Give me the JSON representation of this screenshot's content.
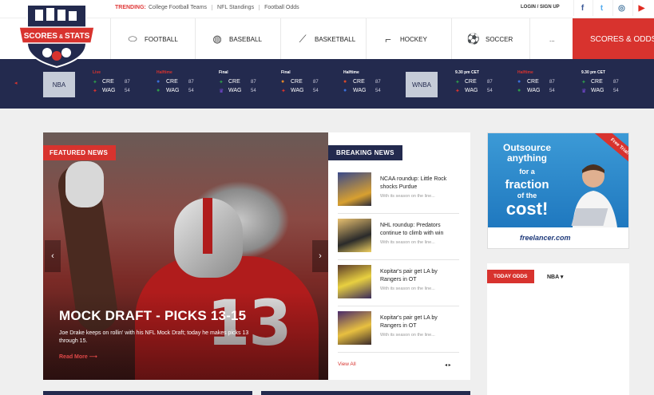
{
  "trending": {
    "label": "TRENDING:",
    "links": [
      "College Football Teams",
      "NFL Standings",
      "Football Odds"
    ]
  },
  "account": {
    "login": "LOGIN / SIGN UP"
  },
  "social": [
    {
      "name": "facebook-icon",
      "glyph": "f",
      "color": "#3b5998"
    },
    {
      "name": "twitter-icon",
      "glyph": "t",
      "color": "#55acee"
    },
    {
      "name": "instagram-icon",
      "glyph": "◎",
      "color": "#3f729b"
    },
    {
      "name": "youtube-icon",
      "glyph": "▶",
      "color": "#e02a20"
    }
  ],
  "logo": {
    "line1": "SCORES",
    "amp": "&",
    "line2": "STATS"
  },
  "nav": {
    "items": [
      {
        "label": "FOOTBALL",
        "icon": "football-icon",
        "glyph": "⬭"
      },
      {
        "label": "BASEBALL",
        "icon": "baseball-icon",
        "glyph": "◍"
      },
      {
        "label": "BASKETBALL",
        "icon": "basketball-icon",
        "glyph": "⟋"
      },
      {
        "label": "HOCKEY",
        "icon": "hockey-stick-icon",
        "glyph": "⌐"
      },
      {
        "label": "SOCCER",
        "icon": "soccer-ball-icon",
        "glyph": "⚽"
      },
      {
        "label": "...",
        "icon": "",
        "glyph": ""
      }
    ],
    "scores_label": "SCORES & ODDS"
  },
  "scores": {
    "leagues": [
      "NBA",
      "WNBA"
    ],
    "games": [
      {
        "status": "Live",
        "status_color": "#d8332e",
        "team1": "CRE",
        "score1": "87",
        "team2": "WAG",
        "score2": "54",
        "i1": "✦",
        "c1": "#2e9a4a",
        "i2": "✦",
        "c2": "#d8332e"
      },
      {
        "status": "Halftime",
        "status_color": "#d8332e",
        "team1": "CRE",
        "score1": "87",
        "team2": "WAG",
        "score2": "54",
        "i1": "●",
        "c1": "#3a6fd8",
        "i2": "●",
        "c2": "#2e9a4a"
      },
      {
        "status": "Final",
        "status_color": "#ffffff",
        "team1": "CRE",
        "score1": "87",
        "team2": "WAG",
        "score2": "54",
        "i1": "✦",
        "c1": "#2e9a4a",
        "i2": "♛",
        "c2": "#7a4ad8"
      },
      {
        "status": "Final",
        "status_color": "#ffffff",
        "team1": "CRE",
        "score1": "87",
        "team2": "WAG",
        "score2": "54",
        "i1": "●",
        "c1": "#e0862a",
        "i2": "✦",
        "c2": "#d8332e"
      },
      {
        "status": "Halftime",
        "status_color": "#ffffff",
        "team1": "CRE",
        "score1": "87",
        "team2": "WAG",
        "score2": "54",
        "i1": "●",
        "c1": "#d84a2a",
        "i2": "●",
        "c2": "#3a6fd8"
      },
      {
        "status": "9.30 pm CET",
        "status_color": "#ffffff",
        "team1": "CRE",
        "score1": "87",
        "team2": "WAG",
        "score2": "54",
        "i1": "✦",
        "c1": "#2e9a4a",
        "i2": "✦",
        "c2": "#d8332e"
      },
      {
        "status": "Halftime",
        "status_color": "#d8332e",
        "team1": "CRE",
        "score1": "87",
        "team2": "WAG",
        "score2": "54",
        "i1": "●",
        "c1": "#3a6fd8",
        "i2": "●",
        "c2": "#2e9a4a"
      },
      {
        "status": "9.30 pm CET",
        "status_color": "#ffffff",
        "team1": "CRE",
        "score1": "87",
        "team2": "WAG",
        "score2": "54",
        "i1": "✦",
        "c1": "#2e9a4a",
        "i2": "♛",
        "c2": "#7a4ad8"
      }
    ]
  },
  "featured": {
    "tag": "FEATURED NEWS",
    "jersey_number": "13",
    "title": "MOCK DRAFT - PICKS 13-15",
    "description": "Joe Drake keeps on rollin' with his NFL Mock Draft; today he makes picks 13 through 15.",
    "read_more": "Read More ⟶"
  },
  "breaking": {
    "tag": "BREAKING NEWS",
    "items": [
      {
        "title": "NCAA roundup: Little Rock shocks Purdue",
        "sub": "With its season on the line..."
      },
      {
        "title": "NHL roundup: Predators continue to climb with win",
        "sub": "With its season on the line..."
      },
      {
        "title": "Kopitar's pair get LA by Rangers in OT",
        "sub": "With its season on the line..."
      },
      {
        "title": "Kopitar's pair get LA by Rangers in OT",
        "sub": "With its season on the line..."
      }
    ],
    "view_all": "View All",
    "pager": "◂ ▸"
  },
  "ad": {
    "line1": "Outsource anything",
    "line2": "for a",
    "line3": "fraction",
    "line4": "of the",
    "line5": "cost!",
    "ribbon": "Free Trial!",
    "brand": "freelancer.com"
  },
  "odds": {
    "tag": "TODAY ODDS",
    "league": "NBA ▾"
  },
  "colors": {
    "brand_red": "#d8332e",
    "navy": "#232a4e"
  }
}
